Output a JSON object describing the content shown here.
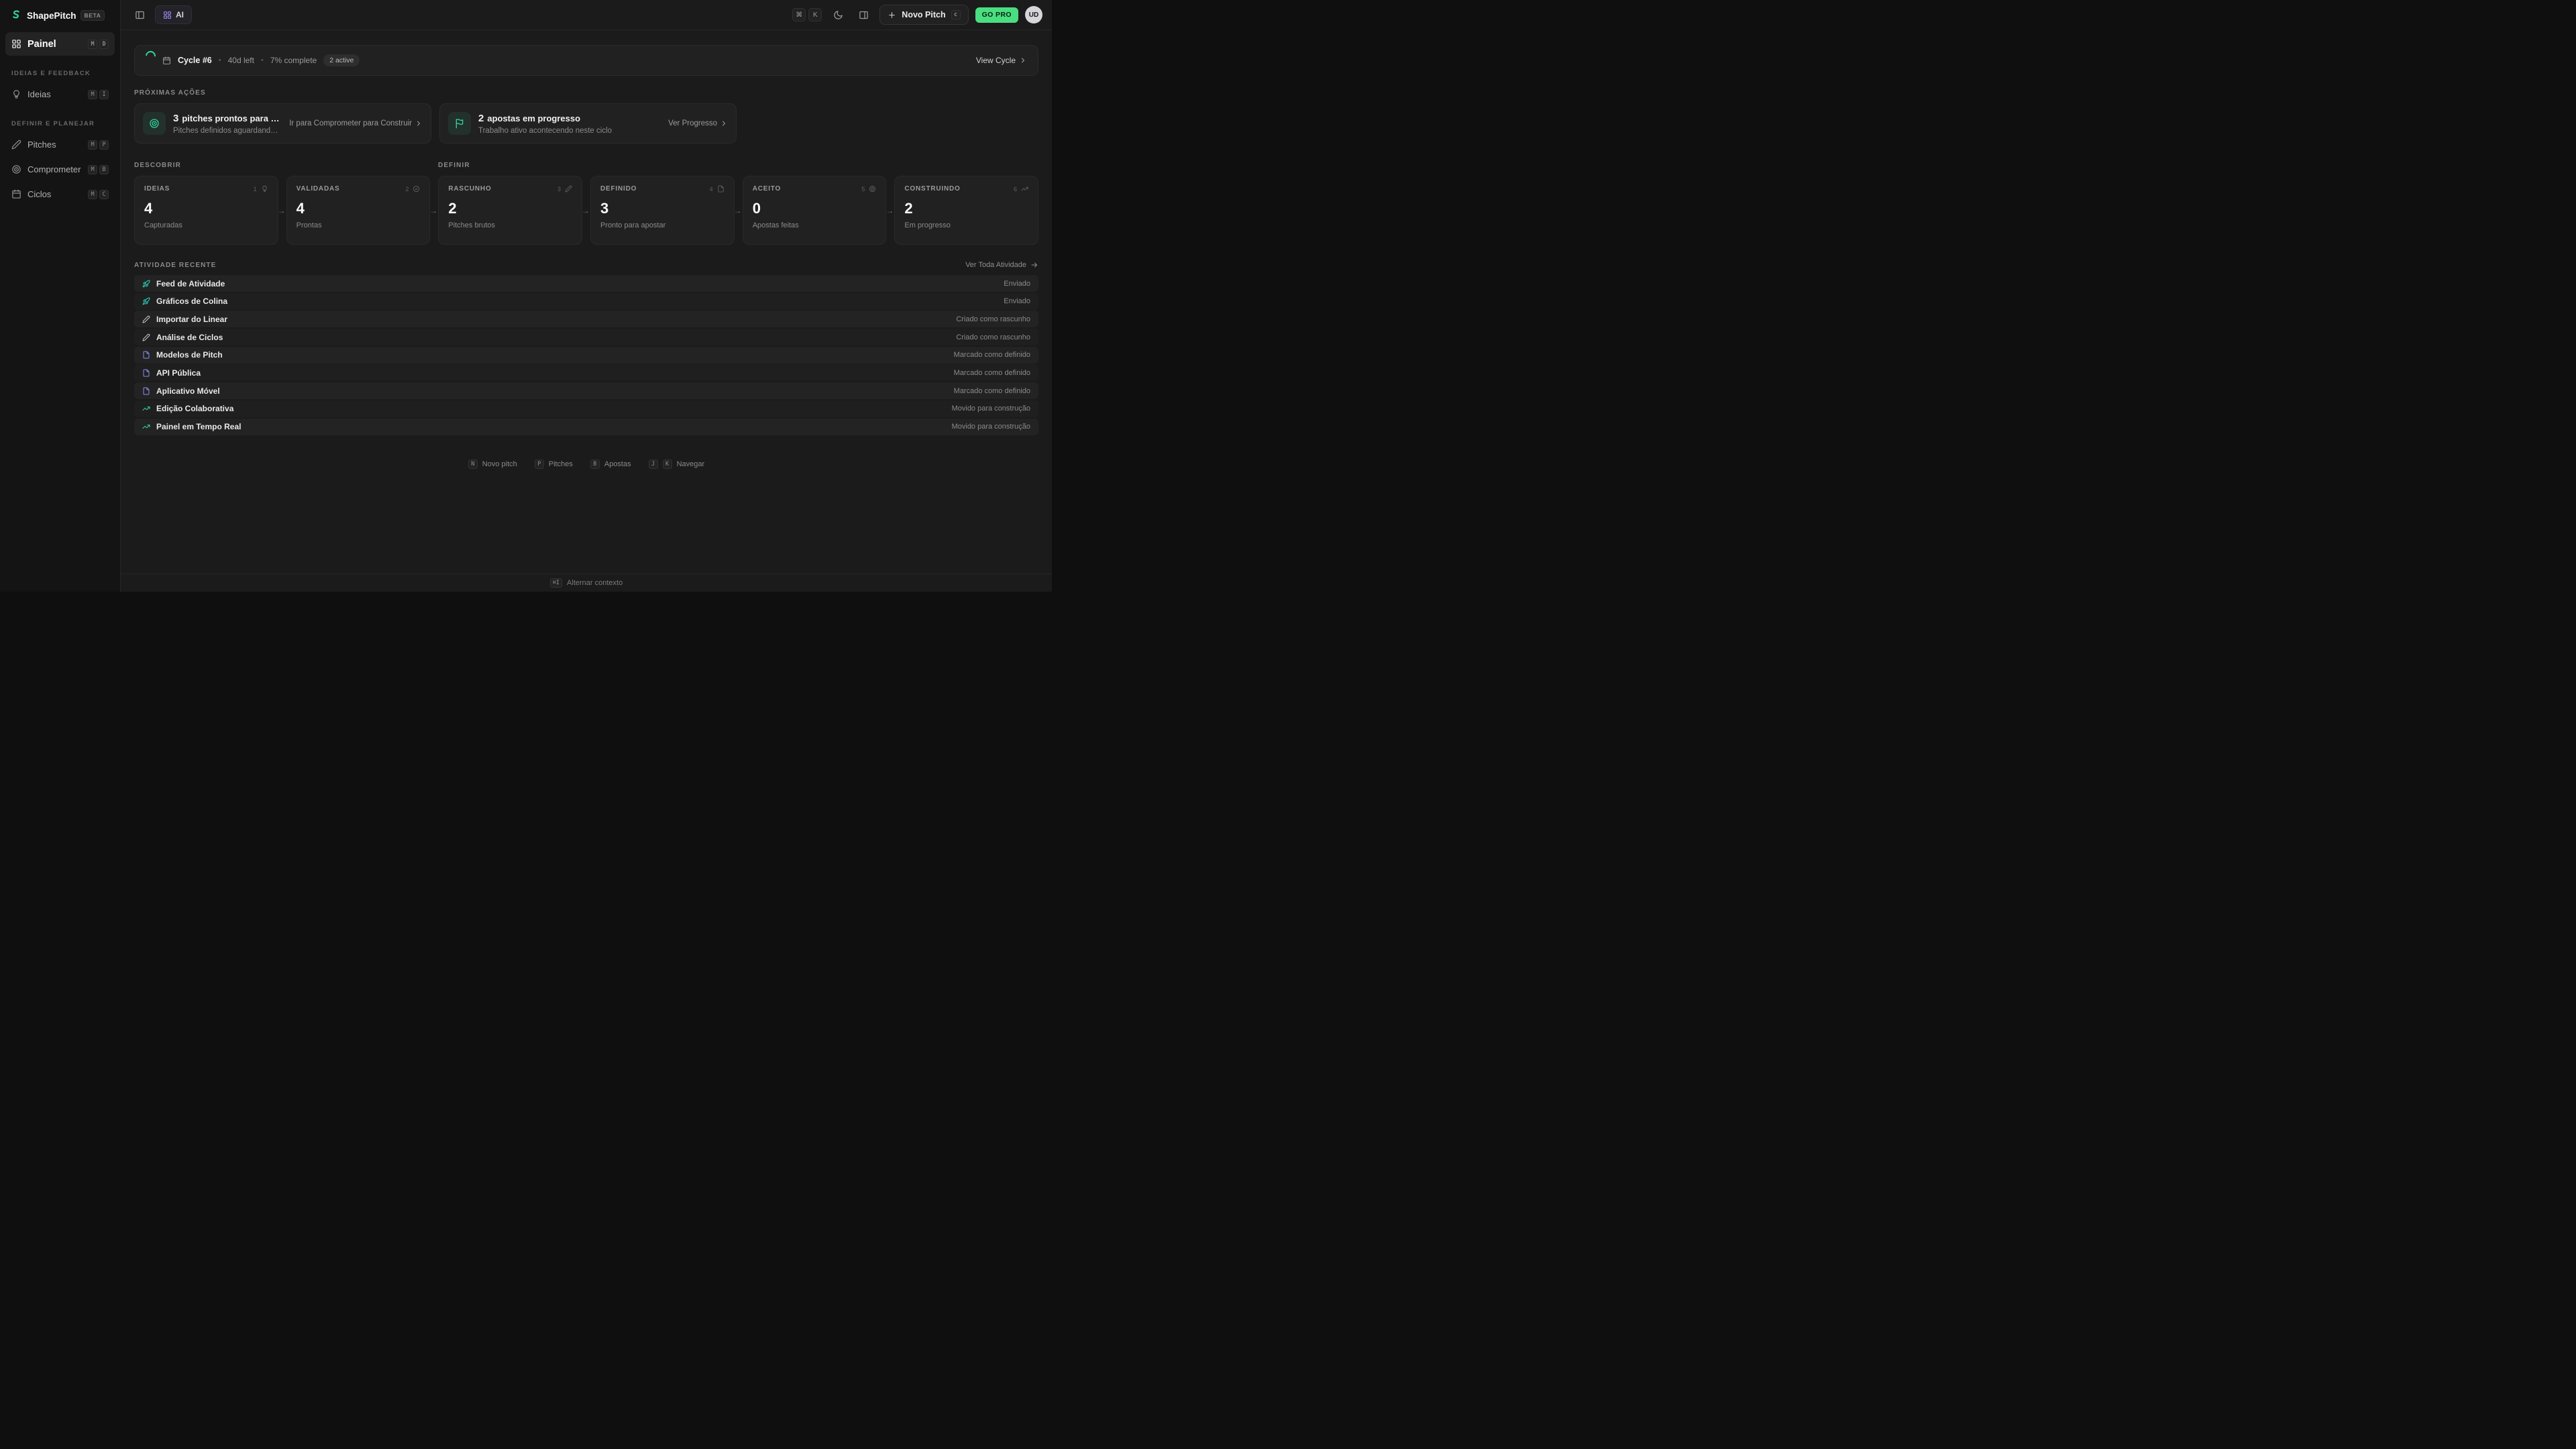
{
  "app": {
    "name": "ShapePitch",
    "badge": "BETA"
  },
  "topbar": {
    "ai_label": "AI",
    "kbd_cmd": "⌘",
    "kbd_k": "K",
    "new_pitch_label": "Novo Pitch",
    "new_pitch_kbd": "c",
    "go_pro_label": "GO PRO",
    "avatar_initials": "UD"
  },
  "sidebar": {
    "main_item": {
      "label": "Painel",
      "kbd": [
        "M",
        "D"
      ]
    },
    "sections": [
      {
        "title": "IDEIAS E FEEDBACK",
        "items": [
          {
            "label": "Ideias",
            "kbd": [
              "M",
              "I"
            ],
            "icon": "lightbulb"
          }
        ]
      },
      {
        "title": "DEFINIR E PLANEJAR",
        "items": [
          {
            "label": "Pitches",
            "kbd": [
              "M",
              "P"
            ],
            "icon": "pencil"
          },
          {
            "label": "Comprometer",
            "kbd": [
              "M",
              "B"
            ],
            "icon": "target"
          },
          {
            "label": "Ciclos",
            "kbd": [
              "M",
              "C"
            ],
            "icon": "calendar"
          }
        ]
      }
    ]
  },
  "cycle_banner": {
    "title": "Cycle #6",
    "days_left": "40d left",
    "complete": "7% complete",
    "active_badge": "2 active",
    "link": "View Cycle",
    "separator": "•"
  },
  "next_actions": {
    "heading": "PRÓXIMAS AÇÕES",
    "cards": [
      {
        "icon": "target",
        "count": "3",
        "title": "pitches prontos para compr...",
        "subtitle": "Pitches definidos aguardando na ...",
        "link": "Ir para Comprometer para Construir"
      },
      {
        "icon": "flag",
        "count": "2",
        "title": "apostas em progresso",
        "subtitle": "Trabalho ativo acontecendo neste ciclo",
        "link": "Ver Progresso"
      }
    ]
  },
  "pipeline": {
    "group_labels": [
      "DESCOBRIR",
      "DEFINIR"
    ],
    "stages": [
      {
        "name": "IDEIAS",
        "step": "1",
        "icon": "lightbulb",
        "value": "4",
        "caption": "Capturadas"
      },
      {
        "name": "VALIDADAS",
        "step": "2",
        "icon": "check-circle",
        "value": "4",
        "caption": "Prontas"
      },
      {
        "name": "RASCUNHO",
        "step": "3",
        "icon": "pencil",
        "value": "2",
        "caption": "Pitches brutos"
      },
      {
        "name": "DEFINIDO",
        "step": "4",
        "icon": "file",
        "value": "3",
        "caption": "Pronto para apostar"
      },
      {
        "name": "ACEITO",
        "step": "5",
        "icon": "target",
        "value": "0",
        "caption": "Apostas feitas"
      },
      {
        "name": "CONSTRUINDO",
        "step": "6",
        "icon": "trending-up",
        "value": "2",
        "caption": "Em progresso"
      }
    ],
    "arrow": "→"
  },
  "activity": {
    "heading": "ATIVIDADE RECENTE",
    "link": "Ver Toda Atividade",
    "rows": [
      {
        "icon": "rocket",
        "title": "Feed de Atividade",
        "status": "Enviado"
      },
      {
        "icon": "rocket",
        "title": "Gráficos de Colina",
        "status": "Enviado"
      },
      {
        "icon": "pencil",
        "title": "Importar do Linear",
        "status": "Criado como rascunho"
      },
      {
        "icon": "pencil",
        "title": "Análise de Ciclos",
        "status": "Criado como rascunho"
      },
      {
        "icon": "file",
        "title": "Modelos de Pitch",
        "status": "Marcado como definido"
      },
      {
        "icon": "file",
        "title": "API Pública",
        "status": "Marcado como definido"
      },
      {
        "icon": "file",
        "title": "Aplicativo Móvel",
        "status": "Marcado como definido"
      },
      {
        "icon": "trending-up",
        "title": "Edição Colaborativa",
        "status": "Movido para construção"
      },
      {
        "icon": "trending-up",
        "title": "Painel em Tempo Real",
        "status": "Movido para construção"
      }
    ]
  },
  "shortcuts": {
    "items": [
      {
        "keys": [
          "N"
        ],
        "label": "Novo pitch"
      },
      {
        "keys": [
          "P"
        ],
        "label": "Pitches"
      },
      {
        "keys": [
          "B"
        ],
        "label": "Apostas"
      },
      {
        "keys": [
          "J",
          "K"
        ],
        "label": "Navegar"
      }
    ]
  },
  "footer": {
    "kbd": "⌘I",
    "label": "Alternar contexto"
  },
  "colors": {
    "accent_green": "#34d399",
    "go_pro_green": "#4ade80",
    "teal": "#2dd4bf",
    "indigo": "#8b8df0",
    "ai_purple": "#a78bfa"
  }
}
